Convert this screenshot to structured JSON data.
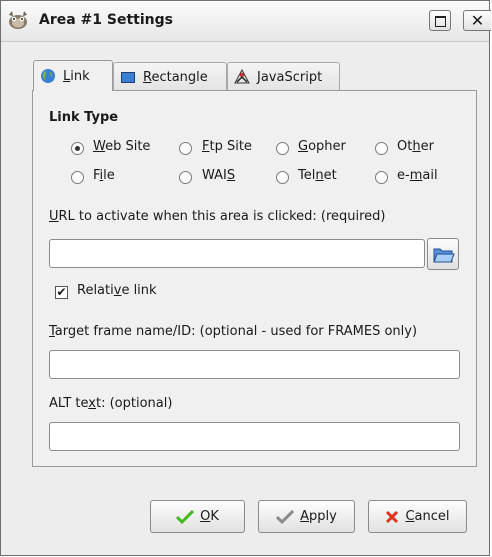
{
  "window": {
    "title": "Area #1 Settings",
    "close_glyph": "✕"
  },
  "tabs": [
    {
      "pre": "",
      "u": "L",
      "post": "ink",
      "icon": "globe-icon"
    },
    {
      "pre": "",
      "u": "R",
      "post": "ectangle",
      "icon": "rectangle-icon"
    },
    {
      "pre": "",
      "u": "J",
      "post": "avaScript",
      "icon": "javascript-icon"
    }
  ],
  "link_type": {
    "heading": "Link Type",
    "options": [
      {
        "pre": "",
        "u": "W",
        "post": "eb Site",
        "checked": true
      },
      {
        "pre": "",
        "u": "F",
        "post": "tp Site",
        "checked": false
      },
      {
        "pre": "",
        "u": "G",
        "post": "opher",
        "checked": false
      },
      {
        "pre": "Ot",
        "u": "h",
        "post": "er",
        "checked": false
      },
      {
        "pre": "F",
        "u": "i",
        "post": "le",
        "checked": false
      },
      {
        "pre": "WAI",
        "u": "S",
        "post": "",
        "checked": false
      },
      {
        "pre": "Tel",
        "u": "n",
        "post": "et",
        "checked": false
      },
      {
        "pre": "e-",
        "u": "m",
        "post": "ail",
        "checked": false
      }
    ]
  },
  "url": {
    "pre": "",
    "u": "U",
    "post": "RL to activate when this area is clicked: (required)",
    "value": ""
  },
  "relative": {
    "pre": "Relati",
    "u": "v",
    "post": "e link",
    "checked": true
  },
  "target": {
    "pre": "",
    "u": "T",
    "post": "arget frame name/ID: (optional - used for FRAMES only)",
    "value": ""
  },
  "alt": {
    "pre": "ALT te",
    "u": "x",
    "post": "t: (optional)",
    "value": ""
  },
  "buttons": {
    "ok": {
      "pre": "",
      "u": "O",
      "post": "K"
    },
    "apply": {
      "pre": "",
      "u": "A",
      "post": "pply"
    },
    "cancel": {
      "pre": "",
      "u": "C",
      "post": "ancel"
    }
  },
  "colors": {
    "ok_check": "#44b91e",
    "cancel_x": "#e2331f",
    "accent_blue": "#3b7fd3"
  }
}
